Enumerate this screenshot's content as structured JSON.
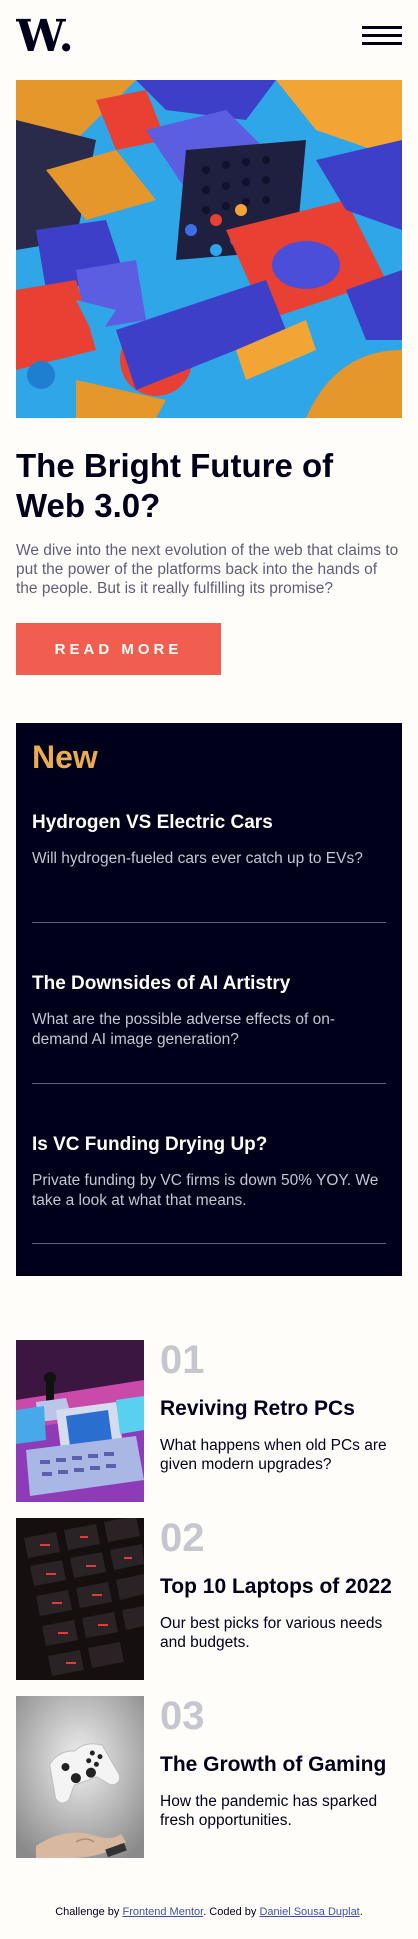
{
  "header": {
    "logo_text": "W.",
    "menu_icon": "hamburger-icon"
  },
  "hero": {
    "image_icon": "abstract-3d-blocks-image",
    "title": "The Bright Future of Web 3.0?",
    "description": "We dive into the next evolution of the web that claims to put the power of the platforms back into the hands of the people. But is it really fulfilling its promise?",
    "button_label": "READ MORE"
  },
  "new_section": {
    "heading": "New",
    "items": [
      {
        "title": "Hydrogen VS Electric Cars",
        "description": "Will hydrogen-fueled cars ever catch up to EVs?"
      },
      {
        "title": "The Downsides of AI Artistry",
        "description": "What are the possible adverse effects of on-demand AI image generation?"
      },
      {
        "title": "Is VC Funding Drying Up?",
        "description": "Private funding by VC firms is down 50% YOY. We take a look at what that means."
      }
    ]
  },
  "cards": [
    {
      "number": "01",
      "title": "Reviving Retro PCs",
      "description": "What happens when old PCs are given modern upgrades?",
      "image_icon": "retro-pc-image"
    },
    {
      "number": "02",
      "title": "Top 10 Laptops of 2022",
      "description": "Our best picks for various needs and budgets.",
      "image_icon": "laptop-keyboard-image"
    },
    {
      "number": "03",
      "title": "The Growth of Gaming",
      "description": "How the pandemic has sparked fresh opportunities.",
      "image_icon": "gamepad-image"
    }
  ],
  "footer": {
    "prefix": "Challenge by ",
    "link1": "Frontend Mentor",
    "middle": ". Coded by ",
    "link2": "Daniel Sousa Duplat",
    "suffix": "."
  },
  "colors": {
    "accent_red": "#f15e50",
    "accent_orange": "#e9ab53",
    "dark_navy": "#00001a",
    "grayish_blue": "#5d5f79",
    "off_white": "#fffdfa"
  }
}
